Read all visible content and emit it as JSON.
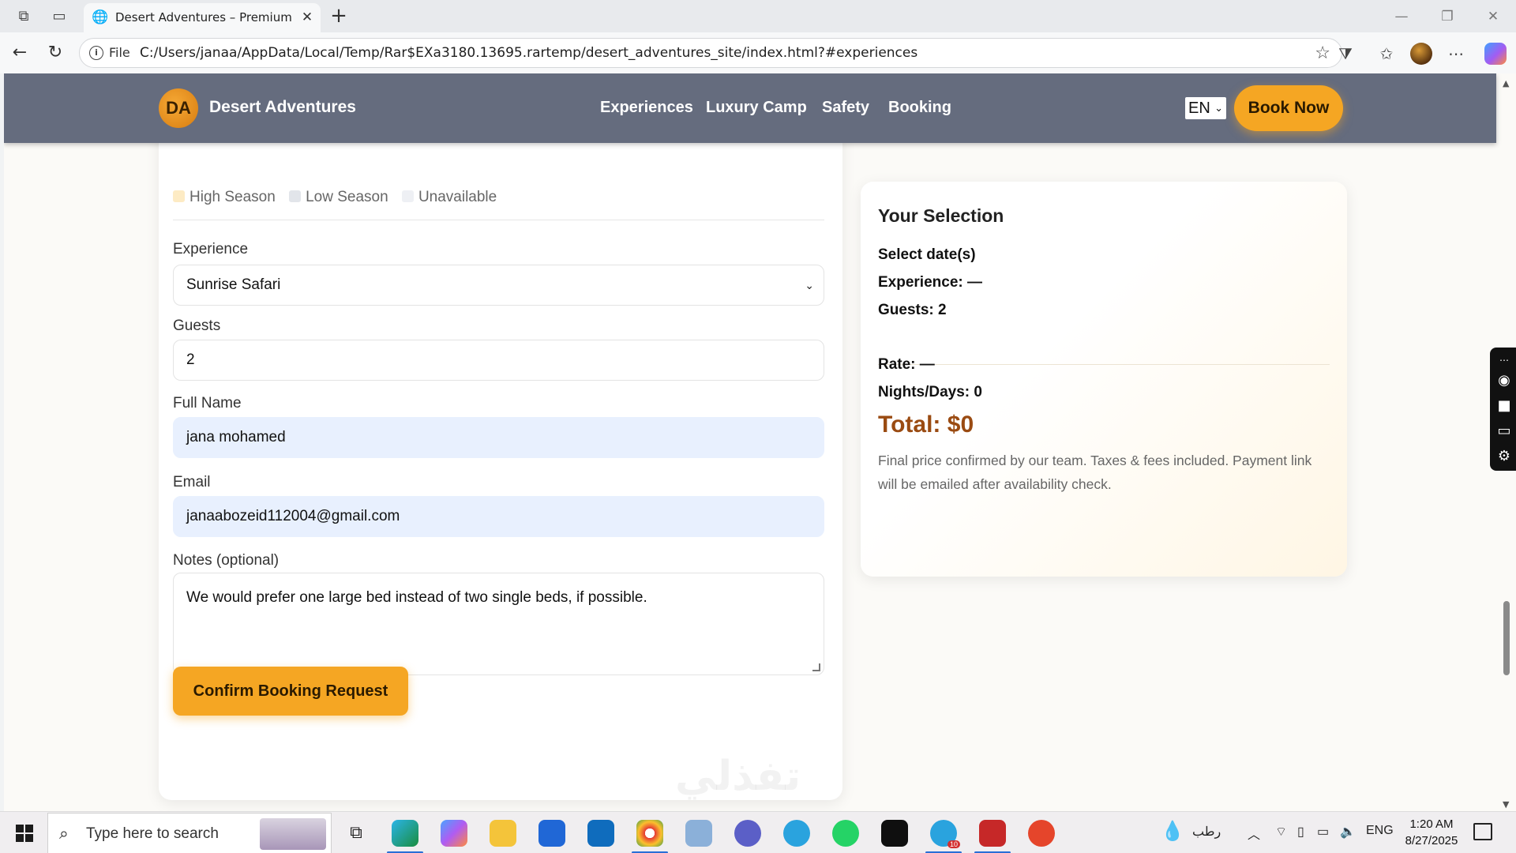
{
  "browser": {
    "tab_title": "Desert Adventures – Premium Saf",
    "url_scheme_label": "File",
    "url": "C:/Users/janaa/AppData/Local/Temp/Rar$EXa3180.13695.rartemp/desert_adventures_site/index.html?#experiences"
  },
  "site": {
    "logo_initials": "DA",
    "brand": "Desert Adventures",
    "nav": [
      "Experiences",
      "Luxury Camp",
      "Safety",
      "Booking"
    ],
    "language": "EN",
    "book_now": "Book Now"
  },
  "form": {
    "legend": [
      "High Season",
      "Low Season",
      "Unavailable"
    ],
    "legend_colors": [
      "#fdebc4",
      "#e2e5ea",
      "#eef0f4"
    ],
    "experience_label": "Experience",
    "experience_value": "Sunrise Safari",
    "guests_label": "Guests",
    "guests_value": "2",
    "name_label": "Full Name",
    "name_value": "jana mohamed",
    "email_label": "Email",
    "email_value": "janaabozeid112004@gmail.com",
    "notes_label": "Notes (optional)",
    "notes_value": "We would prefer one large bed instead of two single beds, if possible.",
    "confirm_button": "Confirm Booking Request"
  },
  "summary": {
    "title": "Your Selection",
    "dates": "Select date(s)",
    "experience": "Experience: —",
    "guests": "Guests: 2",
    "rate": "Rate: —",
    "nights": "Nights/Days: 0",
    "total": "Total: $0",
    "note": "Final price confirmed by our team. Taxes & fees included. Payment link will be emailed after availability check."
  },
  "watermark": "ﺗﻔﺬﻟﻲ",
  "taskbar": {
    "search_placeholder": "Type here to search",
    "weather_text": "رطب",
    "lang": "ENG",
    "time": "1:20 AM",
    "date": "8/27/2025",
    "telegram_badge": "10"
  },
  "colors": {
    "header_bg": "#656c7e",
    "accent": "#f5a623",
    "total_color": "#9a4b12",
    "autofill_bg": "#e8f0fe"
  }
}
